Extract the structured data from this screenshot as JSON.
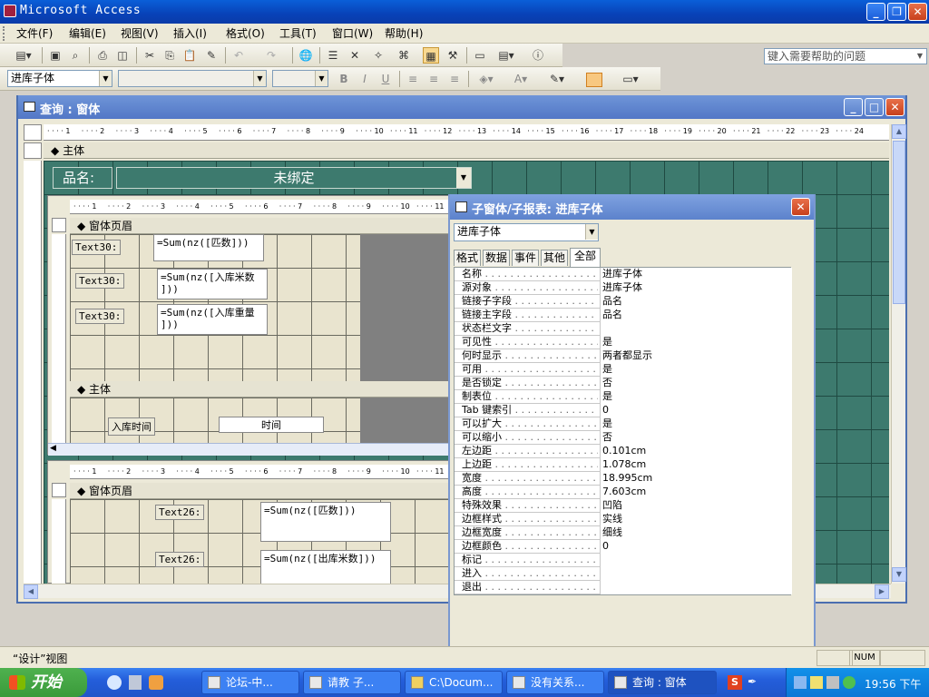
{
  "app": {
    "title": "Microsoft Access"
  },
  "menu": [
    "文件(F)",
    "编辑(E)",
    "视图(V)",
    "插入(I)",
    "格式(O)",
    "工具(T)",
    "窗口(W)",
    "帮助(H)"
  ],
  "help_box": {
    "placeholder": "键入需要帮助的问题"
  },
  "format_toolbar": {
    "object_combo": "进库子体",
    "font_combo": "",
    "size_combo": ""
  },
  "form_window": {
    "title": "查询 : 窗体",
    "section_detail": "主体",
    "product_label": "品名:",
    "product_combo": "未绑定"
  },
  "subform1": {
    "header_section": "窗体页眉",
    "detail_section": "主体",
    "controls": [
      {
        "label": "Text30:",
        "expr": "=Sum(nz([匹数]))"
      },
      {
        "label": "Text30:",
        "expr": "=Sum(nz([入库米数\n]))"
      },
      {
        "label": "Text30:",
        "expr": "=Sum(nz([入库重量\n]))"
      }
    ],
    "detail_label": "入库时间",
    "detail_field": "时间"
  },
  "subform2": {
    "header_section": "窗体页眉",
    "controls": [
      {
        "label": "Text26:",
        "expr": "=Sum(nz([匹数]))"
      },
      {
        "label": "Text26:",
        "expr": "=Sum(nz([出库米数]))"
      }
    ]
  },
  "ruler_numbers": [
    "1",
    "2",
    "3",
    "4",
    "5",
    "6",
    "7",
    "8",
    "9",
    "10",
    "11",
    "12",
    "13",
    "14",
    "15",
    "16",
    "17",
    "18",
    "19",
    "20",
    "21",
    "22",
    "23",
    "24"
  ],
  "properties": {
    "title": "子窗体/子报表: 进库子体",
    "object_select": "进库子体",
    "tabs": [
      "格式",
      "数据",
      "事件",
      "其他",
      "全部"
    ],
    "active_tab": "全部",
    "rows": [
      {
        "k": "名称",
        "v": "进库子体"
      },
      {
        "k": "源对象",
        "v": "进库子体"
      },
      {
        "k": "链接子字段",
        "v": "品名"
      },
      {
        "k": "链接主字段",
        "v": "品名"
      },
      {
        "k": "状态栏文字",
        "v": ""
      },
      {
        "k": "可见性",
        "v": "是"
      },
      {
        "k": "何时显示",
        "v": "两者都显示"
      },
      {
        "k": "可用",
        "v": "是"
      },
      {
        "k": "是否锁定",
        "v": "否"
      },
      {
        "k": "制表位",
        "v": "是"
      },
      {
        "k": "Tab 键索引",
        "v": "0"
      },
      {
        "k": "可以扩大",
        "v": "是"
      },
      {
        "k": "可以缩小",
        "v": "否"
      },
      {
        "k": "左边距",
        "v": "0.101cm"
      },
      {
        "k": "上边距",
        "v": "1.078cm"
      },
      {
        "k": "宽度",
        "v": "18.995cm"
      },
      {
        "k": "高度",
        "v": "7.603cm"
      },
      {
        "k": "特殊效果",
        "v": "凹陷"
      },
      {
        "k": "边框样式",
        "v": "实线"
      },
      {
        "k": "边框宽度",
        "v": "细线"
      },
      {
        "k": "边框颜色",
        "v": "0"
      },
      {
        "k": "标记",
        "v": ""
      },
      {
        "k": "进入",
        "v": ""
      },
      {
        "k": "退出",
        "v": ""
      }
    ]
  },
  "status_bar": {
    "mode": "“设计”视图",
    "num": "NUM"
  },
  "taskbar": {
    "start": "开始",
    "tasks": [
      "论坛-中...",
      "请教 子...",
      "C:\\Docum...",
      "没有关系...",
      "查询 : 窗体"
    ],
    "clock": "19:56 下午"
  }
}
